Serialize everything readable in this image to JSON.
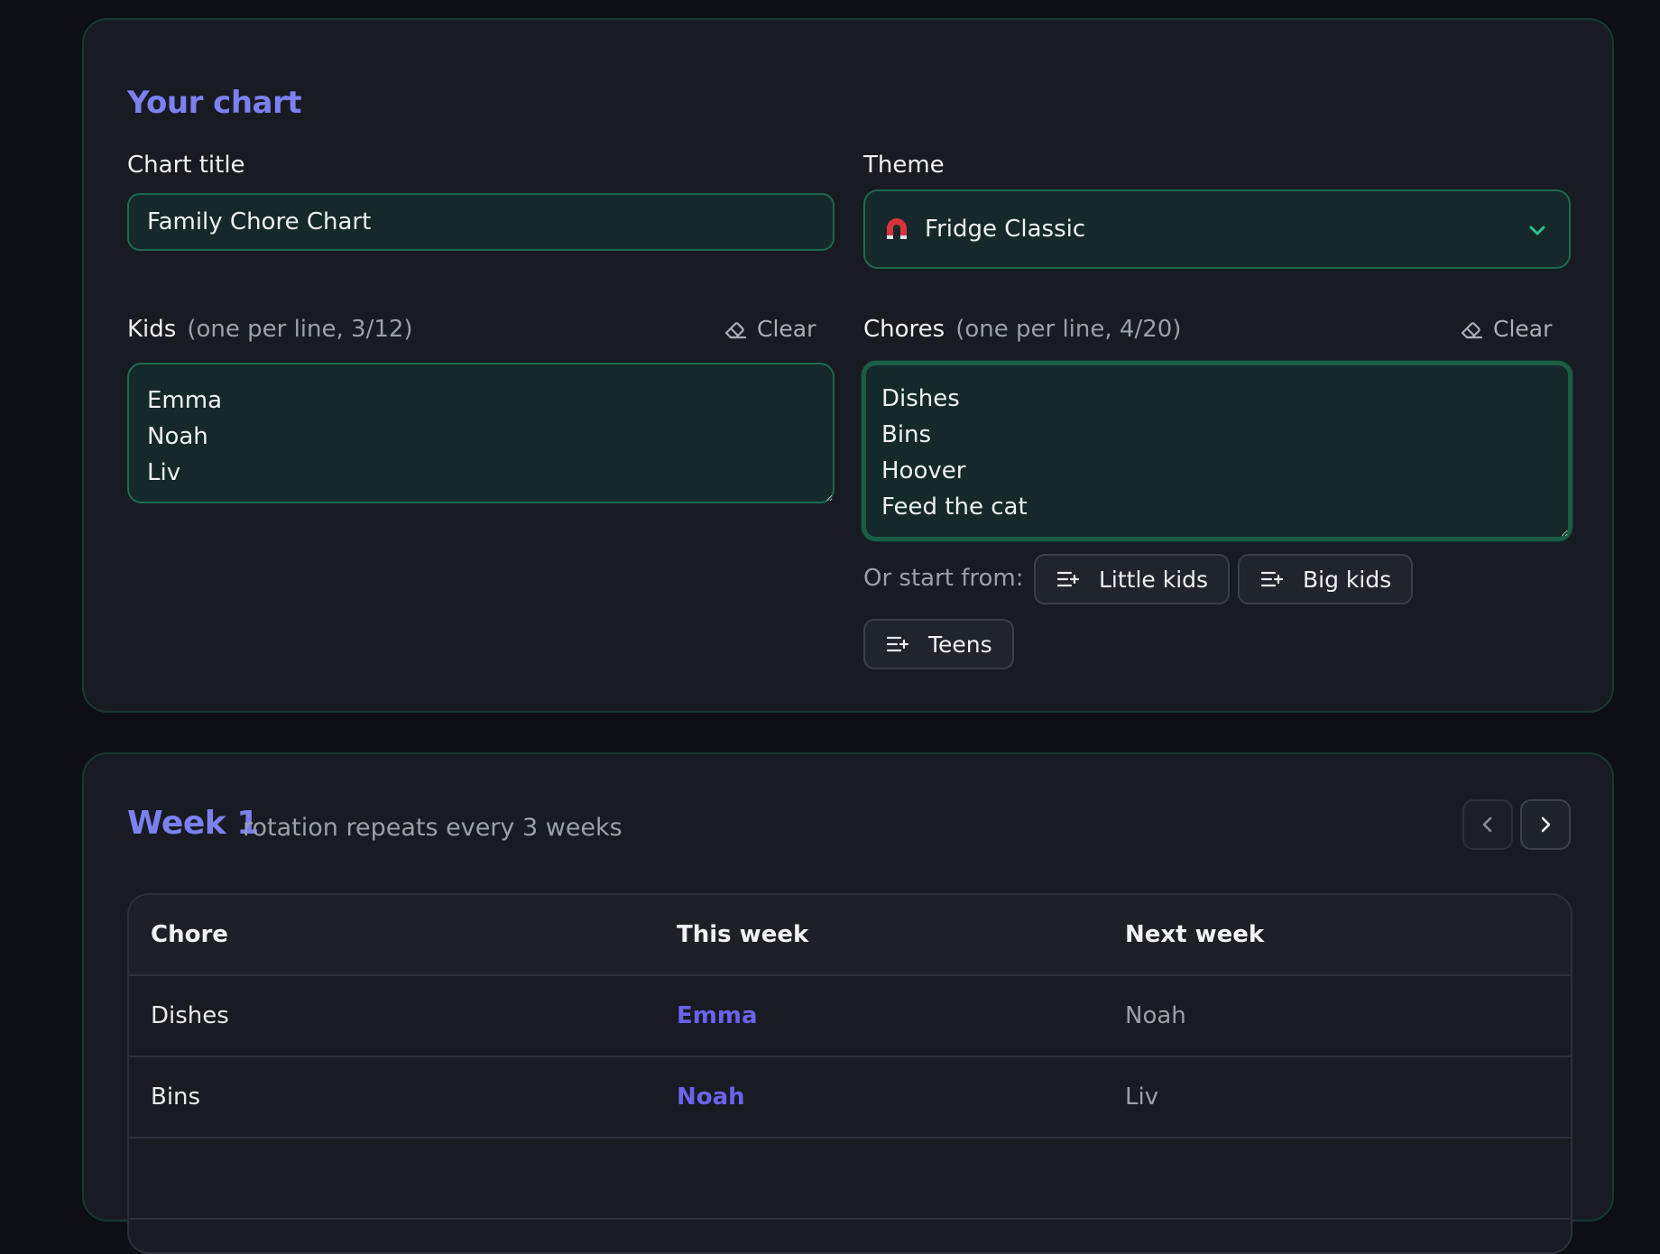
{
  "settings": {
    "heading": "Your chart",
    "title_label": "Chart title",
    "title_value": "Family Chore Chart",
    "theme_label": "Theme",
    "theme_value": "Fridge Classic",
    "theme_icon": "magnet-icon",
    "kids": {
      "label": "Kids",
      "hint": "(one per line, 3/12)",
      "clear_label": "Clear",
      "value": "Emma\nNoah\nLiv"
    },
    "chores": {
      "label": "Chores",
      "hint": "(one per line, 4/20)",
      "clear_label": "Clear",
      "value": "Dishes\nBins\nHoover\nFeed the cat"
    },
    "start_from_label": "Or start from:",
    "presets": [
      "Little kids",
      "Big kids",
      "Teens"
    ]
  },
  "week": {
    "title": "Week 1",
    "subtitle": "rotation repeats every 3 weeks",
    "columns": [
      "Chore",
      "This week",
      "Next week"
    ],
    "rows": [
      {
        "chore": "Dishes",
        "this_week": "Emma",
        "next_week": "Noah"
      },
      {
        "chore": "Bins",
        "this_week": "Noah",
        "next_week": "Liv"
      }
    ]
  },
  "colors": {
    "accent": "#7c80f0",
    "assignee": "#6a63ec",
    "field_border": "#1c6a4d",
    "field_bg": "#15292a",
    "card_bg": "#181b22",
    "page_bg": "#0d0f14"
  }
}
